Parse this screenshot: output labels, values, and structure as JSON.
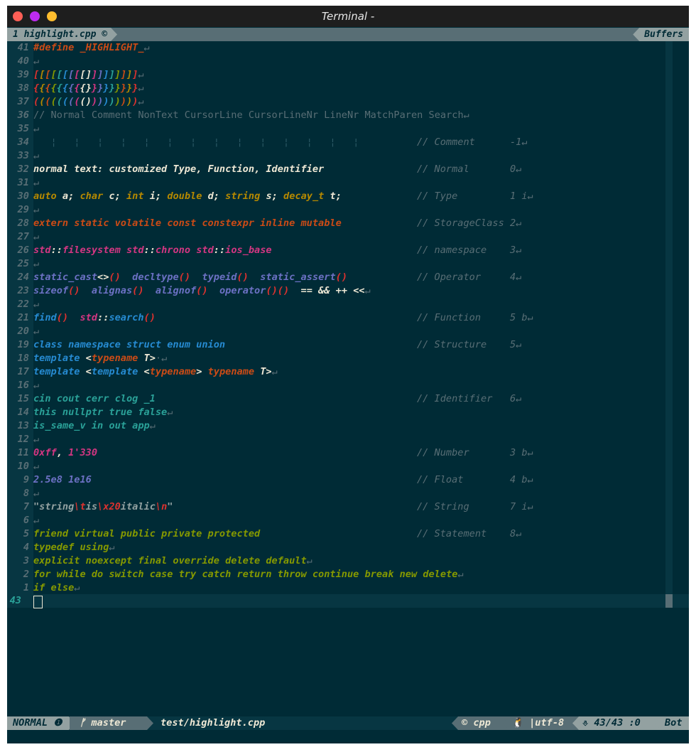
{
  "window": {
    "title": "Terminal -"
  },
  "tabline": {
    "active_tab": "1 highlight.cpp ©",
    "buffers_label": "Buffers"
  },
  "editor": {
    "eol_glyph": "↵",
    "lines": [
      {
        "n": "41",
        "code": [
          {
            "t": "#define _HIGHLIGHT_",
            "c": "pre"
          }
        ]
      },
      {
        "n": "40",
        "code": []
      },
      {
        "n": "39",
        "code": [
          {
            "t": "[",
            "c": "punc"
          },
          {
            "t": "[",
            "c": "type"
          },
          {
            "t": "[",
            "c": "stor"
          },
          {
            "t": "[",
            "c": "stmt"
          },
          {
            "t": "[",
            "c": "id"
          },
          {
            "t": "[",
            "c": "fn"
          },
          {
            "t": "[",
            "c": "op"
          },
          {
            "t": "[",
            "c": "ns"
          },
          {
            "t": "[",
            "c": "txt"
          },
          {
            "t": "]",
            "c": "txt"
          },
          {
            "t": "]",
            "c": "ns"
          },
          {
            "t": "]",
            "c": "op"
          },
          {
            "t": "]",
            "c": "fn"
          },
          {
            "t": "]",
            "c": "id"
          },
          {
            "t": "]",
            "c": "stmt"
          },
          {
            "t": "]",
            "c": "stor"
          },
          {
            "t": "]",
            "c": "type"
          },
          {
            "t": "]",
            "c": "punc"
          }
        ]
      },
      {
        "n": "38",
        "code": [
          {
            "t": "{",
            "c": "punc"
          },
          {
            "t": "{",
            "c": "type"
          },
          {
            "t": "{",
            "c": "stor"
          },
          {
            "t": "{",
            "c": "stmt"
          },
          {
            "t": "{",
            "c": "id"
          },
          {
            "t": "{",
            "c": "fn"
          },
          {
            "t": "{",
            "c": "op"
          },
          {
            "t": "{",
            "c": "ns"
          },
          {
            "t": "{",
            "c": "txt"
          },
          {
            "t": "}",
            "c": "txt"
          },
          {
            "t": "}",
            "c": "ns"
          },
          {
            "t": "}",
            "c": "op"
          },
          {
            "t": "}",
            "c": "fn"
          },
          {
            "t": "}",
            "c": "id"
          },
          {
            "t": "}",
            "c": "stmt"
          },
          {
            "t": "}",
            "c": "stor"
          },
          {
            "t": "}",
            "c": "type"
          },
          {
            "t": "}",
            "c": "punc"
          }
        ]
      },
      {
        "n": "37",
        "code": [
          {
            "t": "(",
            "c": "punc"
          },
          {
            "t": "(",
            "c": "type"
          },
          {
            "t": "(",
            "c": "stor"
          },
          {
            "t": "(",
            "c": "stmt"
          },
          {
            "t": "(",
            "c": "id"
          },
          {
            "t": "(",
            "c": "fn"
          },
          {
            "t": "(",
            "c": "op"
          },
          {
            "t": "(",
            "c": "ns"
          },
          {
            "t": "(",
            "c": "txt"
          },
          {
            "t": ")",
            "c": "txt"
          },
          {
            "t": ")",
            "c": "ns"
          },
          {
            "t": ")",
            "c": "op"
          },
          {
            "t": ")",
            "c": "fn"
          },
          {
            "t": ")",
            "c": "id"
          },
          {
            "t": ")",
            "c": "stmt"
          },
          {
            "t": ")",
            "c": "stor"
          },
          {
            "t": ")",
            "c": "type"
          },
          {
            "t": ")",
            "c": "punc"
          }
        ]
      },
      {
        "n": "36",
        "code": [
          {
            "t": "// Normal Comment NonText CursorLine CursorLineNr LineNr MatchParen Search",
            "c": "eol"
          }
        ]
      },
      {
        "n": "35",
        "code": []
      },
      {
        "n": "34",
        "sep": "   ¦   ¦   ¦   ¦   ¦   ¦   ¦   ¦   ¦   ¦   ¦   ¦   ¦   ¦",
        "comment": "// Comment      -1"
      },
      {
        "n": "33",
        "code": []
      },
      {
        "n": "32",
        "code": [
          {
            "t": "normal text: customized Type, Function, Identifier",
            "c": "norm"
          }
        ],
        "comment": "// Normal       0"
      },
      {
        "n": "31",
        "code": []
      },
      {
        "n": "30",
        "code": [
          {
            "t": "auto",
            "c": "type"
          },
          {
            "t": " a; ",
            "c": "norm"
          },
          {
            "t": "char",
            "c": "type"
          },
          {
            "t": " c; ",
            "c": "norm"
          },
          {
            "t": "int",
            "c": "type"
          },
          {
            "t": " i; ",
            "c": "norm"
          },
          {
            "t": "double",
            "c": "type"
          },
          {
            "t": " d; ",
            "c": "norm"
          },
          {
            "t": "string",
            "c": "type"
          },
          {
            "t": " s; ",
            "c": "norm"
          },
          {
            "t": "decay_t",
            "c": "type"
          },
          {
            "t": " t;",
            "c": "norm"
          }
        ],
        "comment": "// Type         1 i"
      },
      {
        "n": "29",
        "code": []
      },
      {
        "n": "28",
        "code": [
          {
            "t": "extern static volatile const constexpr inline mutable",
            "c": "stor"
          }
        ],
        "comment": "// StorageClass 2"
      },
      {
        "n": "27",
        "code": []
      },
      {
        "n": "26",
        "code": [
          {
            "t": "std",
            "c": "ns"
          },
          {
            "t": "::",
            "c": "norm"
          },
          {
            "t": "filesystem",
            "c": "ns"
          },
          {
            "t": " ",
            "c": "norm"
          },
          {
            "t": "std",
            "c": "ns"
          },
          {
            "t": "::",
            "c": "norm"
          },
          {
            "t": "chrono",
            "c": "ns"
          },
          {
            "t": " ",
            "c": "norm"
          },
          {
            "t": "std",
            "c": "ns"
          },
          {
            "t": "::",
            "c": "norm"
          },
          {
            "t": "ios_base",
            "c": "ns"
          }
        ],
        "comment": "// namespace    3"
      },
      {
        "n": "25",
        "code": []
      },
      {
        "n": "24",
        "code": [
          {
            "t": "static_cast",
            "c": "op"
          },
          {
            "t": "<>",
            "c": "norm"
          },
          {
            "t": "()",
            "c": "punc"
          },
          {
            "t": "  ",
            "c": "norm"
          },
          {
            "t": "decltype",
            "c": "op"
          },
          {
            "t": "()",
            "c": "punc"
          },
          {
            "t": "  ",
            "c": "norm"
          },
          {
            "t": "typeid",
            "c": "op"
          },
          {
            "t": "()",
            "c": "punc"
          },
          {
            "t": "  ",
            "c": "norm"
          },
          {
            "t": "static_assert",
            "c": "op"
          },
          {
            "t": "()",
            "c": "punc"
          }
        ],
        "comment": "// Operator     4"
      },
      {
        "n": "23",
        "code": [
          {
            "t": "sizeof",
            "c": "op"
          },
          {
            "t": "()",
            "c": "punc"
          },
          {
            "t": "  ",
            "c": "norm"
          },
          {
            "t": "alignas",
            "c": "op"
          },
          {
            "t": "()",
            "c": "punc"
          },
          {
            "t": "  ",
            "c": "norm"
          },
          {
            "t": "alignof",
            "c": "op"
          },
          {
            "t": "()",
            "c": "punc"
          },
          {
            "t": "  ",
            "c": "norm"
          },
          {
            "t": "operator",
            "c": "op"
          },
          {
            "t": "()()",
            "c": "punc"
          },
          {
            "t": "  == && ++ <<",
            "c": "norm"
          }
        ]
      },
      {
        "n": "22",
        "code": []
      },
      {
        "n": "21",
        "code": [
          {
            "t": "find",
            "c": "fn"
          },
          {
            "t": "()",
            "c": "punc"
          },
          {
            "t": "  ",
            "c": "norm"
          },
          {
            "t": "std",
            "c": "ns"
          },
          {
            "t": "::",
            "c": "norm"
          },
          {
            "t": "search",
            "c": "fn"
          },
          {
            "t": "()",
            "c": "punc"
          }
        ],
        "comment": "// Function     5 b"
      },
      {
        "n": "20",
        "code": []
      },
      {
        "n": "19",
        "code": [
          {
            "t": "class namespace struct enum union",
            "c": "fn"
          }
        ],
        "comment": "// Structure    5"
      },
      {
        "n": "18",
        "code": [
          {
            "t": "template",
            "c": "fn"
          },
          {
            "t": " <",
            "c": "norm"
          },
          {
            "t": "typename",
            "c": "stor"
          },
          {
            "t": " T>",
            "c": "norm"
          },
          {
            "t": "·",
            "c": "eol"
          }
        ]
      },
      {
        "n": "17",
        "code": [
          {
            "t": "template",
            "c": "fn"
          },
          {
            "t": " <",
            "c": "norm"
          },
          {
            "t": "template",
            "c": "fn"
          },
          {
            "t": " <",
            "c": "norm"
          },
          {
            "t": "typename",
            "c": "stor"
          },
          {
            "t": "> ",
            "c": "norm"
          },
          {
            "t": "typename",
            "c": "stor"
          },
          {
            "t": " T>",
            "c": "norm"
          }
        ]
      },
      {
        "n": "16",
        "code": []
      },
      {
        "n": "15",
        "code": [
          {
            "t": "cin cout cerr clog _1",
            "c": "id"
          }
        ],
        "comment": "// Identifier   6"
      },
      {
        "n": "14",
        "code": [
          {
            "t": "this nullptr true false",
            "c": "id"
          }
        ]
      },
      {
        "n": "13",
        "code": [
          {
            "t": "is_same_v in out app",
            "c": "id"
          }
        ]
      },
      {
        "n": "12",
        "code": []
      },
      {
        "n": "11",
        "code": [
          {
            "t": "0xff",
            "c": "num"
          },
          {
            "t": ", ",
            "c": "norm"
          },
          {
            "t": "1'330",
            "c": "num"
          }
        ],
        "comment": "// Number       3 b"
      },
      {
        "n": "10",
        "code": []
      },
      {
        "n": "9",
        "code": [
          {
            "t": "2.5e8 1e16",
            "c": "flt"
          }
        ],
        "comment": "// Float        4 b"
      },
      {
        "n": "8",
        "code": []
      },
      {
        "n": "7",
        "code": [
          {
            "t": "\"string",
            "c": "s"
          },
          {
            "t": "\\t",
            "c": "esc"
          },
          {
            "t": "is",
            "c": "s"
          },
          {
            "t": "\\x20",
            "c": "esc"
          },
          {
            "t": "italic",
            "c": "s"
          },
          {
            "t": "\\n",
            "c": "esc"
          },
          {
            "t": "\"",
            "c": "s"
          }
        ],
        "comment": "// String       7 i"
      },
      {
        "n": "6",
        "code": []
      },
      {
        "n": "5",
        "code": [
          {
            "t": "friend virtual public private protected",
            "c": "stmt"
          }
        ],
        "comment": "// Statement    8"
      },
      {
        "n": "4",
        "code": [
          {
            "t": "typedef using",
            "c": "stmt"
          }
        ]
      },
      {
        "n": "3",
        "code": [
          {
            "t": "explicit noexcept final override delete default",
            "c": "stmt"
          }
        ]
      },
      {
        "n": "2",
        "code": [
          {
            "t": "for while do switch case try catch return throw continue break new delete",
            "c": "stmt"
          }
        ]
      },
      {
        "n": "1",
        "code": [
          {
            "t": "if else",
            "c": "stmt"
          }
        ]
      }
    ],
    "cursor_line_number": "43"
  },
  "statusbar": {
    "mode": "NORMAL ❶",
    "branch": "ᚠ master",
    "file": "test/highlight.cpp",
    "filetype": "© cpp",
    "encoding": "🐧 |utf-8",
    "position": "⎀ 43/43 :0",
    "scroll": "Bot"
  },
  "colors": {
    "background": "#002b36",
    "base02": "#073642",
    "base01": "#586e75",
    "yellow": "#b58900",
    "orange": "#cb4b16",
    "red": "#dc322f",
    "magenta": "#d33682",
    "violet": "#6c71c4",
    "blue": "#268bd2",
    "cyan": "#2aa198",
    "green": "#859900"
  }
}
